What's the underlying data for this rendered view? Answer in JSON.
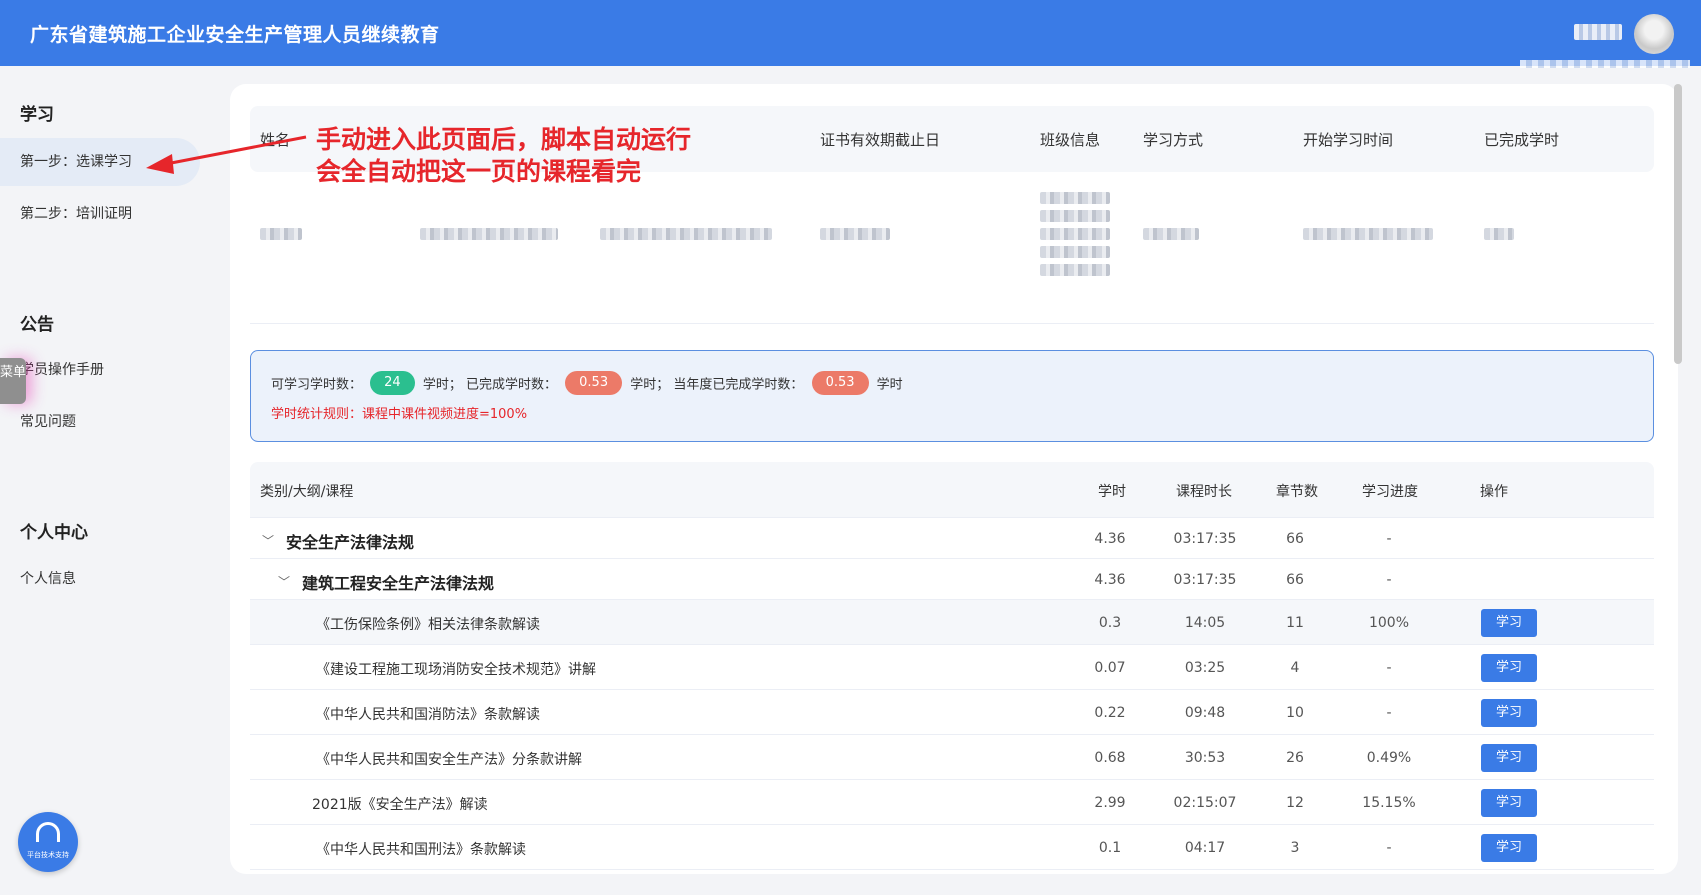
{
  "header": {
    "title": "广东省建筑施工企业安全生产管理人员继续教育",
    "user_name": "",
    "avatar_icon": "user-avatar-icon"
  },
  "sidebar": {
    "groups": [
      {
        "title": "学习",
        "items": [
          {
            "label": "第一步：选课学习",
            "active": true
          },
          {
            "label": "第二步：培训证明",
            "active": false
          }
        ]
      },
      {
        "title": "公告",
        "items": [
          {
            "label": "学员操作手册",
            "active": false
          },
          {
            "label": "常见问题",
            "active": false
          }
        ]
      },
      {
        "title": "个人中心",
        "items": [
          {
            "label": "个人信息",
            "active": false
          }
        ]
      }
    ],
    "menu_tab": "菜单",
    "support_label": "平台技术支持"
  },
  "info": {
    "columns": [
      "姓名",
      "",
      "",
      "证书有效期截止日",
      "班级信息",
      "学习方式",
      "开始学习时间",
      "已完成学时"
    ]
  },
  "stats": {
    "available_label": "可学习学时数：",
    "available_value": "24",
    "unit1": "学时；",
    "completed_label": "已完成学时数：",
    "completed_value": "0.53",
    "unit2": "学时；",
    "year_label": "当年度已完成学时数：",
    "year_value": "0.53",
    "unit3": "学时",
    "rule": "学时统计规则：课程中课件视频进度=100%"
  },
  "courses": {
    "columns": {
      "name": "类别/大纲/课程",
      "hours": "学时",
      "duration": "课程时长",
      "chapters": "章节数",
      "progress": "学习进度",
      "action": "操作"
    },
    "study_label": "学习",
    "rows": [
      {
        "level": 0,
        "name": "安全生产法律法规",
        "hours": "4.36",
        "duration": "03:17:35",
        "chapters": "66",
        "progress": "-",
        "button": false
      },
      {
        "level": 1,
        "name": "建筑工程安全生产法律法规",
        "hours": "4.36",
        "duration": "03:17:35",
        "chapters": "66",
        "progress": "-",
        "button": false
      },
      {
        "level": 2,
        "name": "《工伤保险条例》相关法律条款解读",
        "hours": "0.3",
        "duration": "14:05",
        "chapters": "11",
        "progress": "100%",
        "button": true
      },
      {
        "level": 2,
        "name": "《建设工程施工现场消防安全技术规范》讲解",
        "hours": "0.07",
        "duration": "03:25",
        "chapters": "4",
        "progress": "-",
        "button": true
      },
      {
        "level": 2,
        "name": "《中华人民共和国消防法》条款解读",
        "hours": "0.22",
        "duration": "09:48",
        "chapters": "10",
        "progress": "-",
        "button": true
      },
      {
        "level": 2,
        "name": "《中华人民共和国安全生产法》分条款讲解",
        "hours": "0.68",
        "duration": "30:53",
        "chapters": "26",
        "progress": "0.49%",
        "button": true
      },
      {
        "level": 2,
        "name": "2021版《安全生产法》解读",
        "hours": "2.99",
        "duration": "02:15:07",
        "chapters": "12",
        "progress": "15.15%",
        "button": true
      },
      {
        "level": 2,
        "name": "《中华人民共和国刑法》条款解读",
        "hours": "0.1",
        "duration": "04:17",
        "chapters": "3",
        "progress": "-",
        "button": true
      }
    ]
  },
  "annotation": {
    "line1": "手动进入此页面后，脚本自动运行",
    "line2": "会全自动把这一页的课程看完",
    "color": "#e6262b"
  }
}
